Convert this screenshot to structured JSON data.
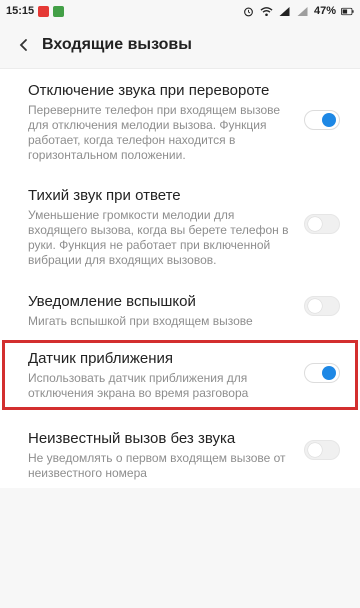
{
  "status_bar": {
    "time": "15:15",
    "battery": "47%",
    "notif_colors": [
      "#e53935",
      "#43a047"
    ]
  },
  "header": {
    "title": "Входящие вызовы",
    "back_icon": "chevron-left-icon"
  },
  "settings": [
    {
      "title": "Отключение звука при перевороте",
      "description": "Переверните телефон при входящем вызове для отключения мелодии вызова. Функция работает, когда телефон находится в горизонтальном положении.",
      "enabled": true
    },
    {
      "title": "Тихий звук при ответе",
      "description": "Уменьшение громкости мелодии для входящего вызова, когда вы берете телефон в руки. Функция не работает при включенной вибрации для входящих вызовов.",
      "enabled": false
    },
    {
      "title": "Уведомление вспышкой",
      "description": "Мигать вспышкой при входящем вызове",
      "enabled": false
    },
    {
      "title": "Датчик приближения",
      "description": "Использовать датчик приближения для отключения экрана во время разговора",
      "enabled": true
    },
    {
      "title": "Неизвестный вызов без звука",
      "description": "Не уведомлять о первом входящем вызове от неизвестного номера",
      "enabled": false
    }
  ],
  "colors": {
    "accent": "#1e88e5",
    "highlight": "#d32f2f"
  }
}
